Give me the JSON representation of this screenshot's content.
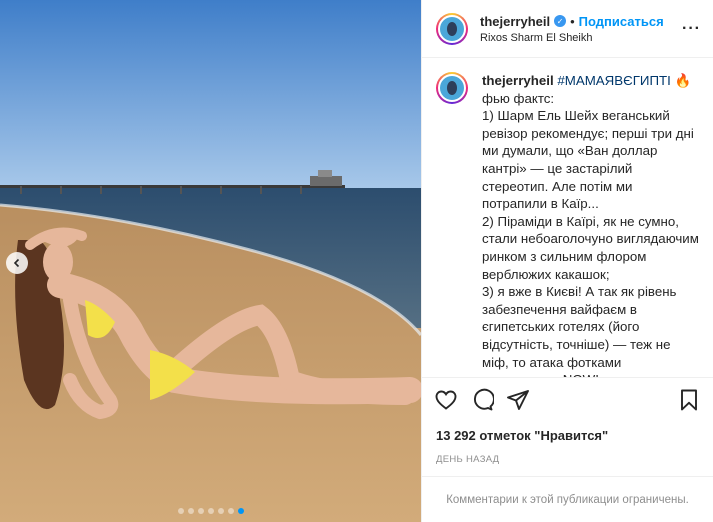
{
  "colors": {
    "accent": "#0095f6",
    "text": "#262626",
    "muted": "#8e8e8e",
    "verified": "#3897f0"
  },
  "header": {
    "username": "thejerryheil",
    "separator": "•",
    "follow_label": "Подписаться",
    "location": "Rixos Sharm El Sheikh",
    "more_icon": "more-horizontal-icon"
  },
  "caption": {
    "username": "thejerryheil",
    "hashtag": "#МАМАЯВЄГИПТІ",
    "emoji": "🔥",
    "body": "фью фактс:\n1) Шарм Ель Шейх веганський ревізор рекомендує; перші три дні ми думали, що «Ван доллар кантрі» — це застарілий стереотип. Але потім ми потрапили в Каїр...\n2) Піраміди в Каїрі, як не сумно, стали небоаголочуно виглядаючим ринком з сильним флором верблюжих какашок;\n3) я вже в Києві! А так як рівень забезпечення вайфаєм в єгипетських готелях (його відсутність, точніше) — теж не міф, то атака фотками починається NOW!\n\nЗ вас по коментарю про ваш досвід з Єгиптом🔥 що сподобалося, що важливо побачити (окрім очевидного)"
  },
  "actions": {
    "like_icon": "heart-icon",
    "comment_icon": "comment-icon",
    "share_icon": "share-icon",
    "save_icon": "bookmark-icon"
  },
  "likes": "13 292 отметок \"Нравится\"",
  "timestamp": "День назад",
  "footer": "Комментарии к этой публикации ограничены.",
  "carousel": {
    "slide_count": 7,
    "active_index": 6
  }
}
